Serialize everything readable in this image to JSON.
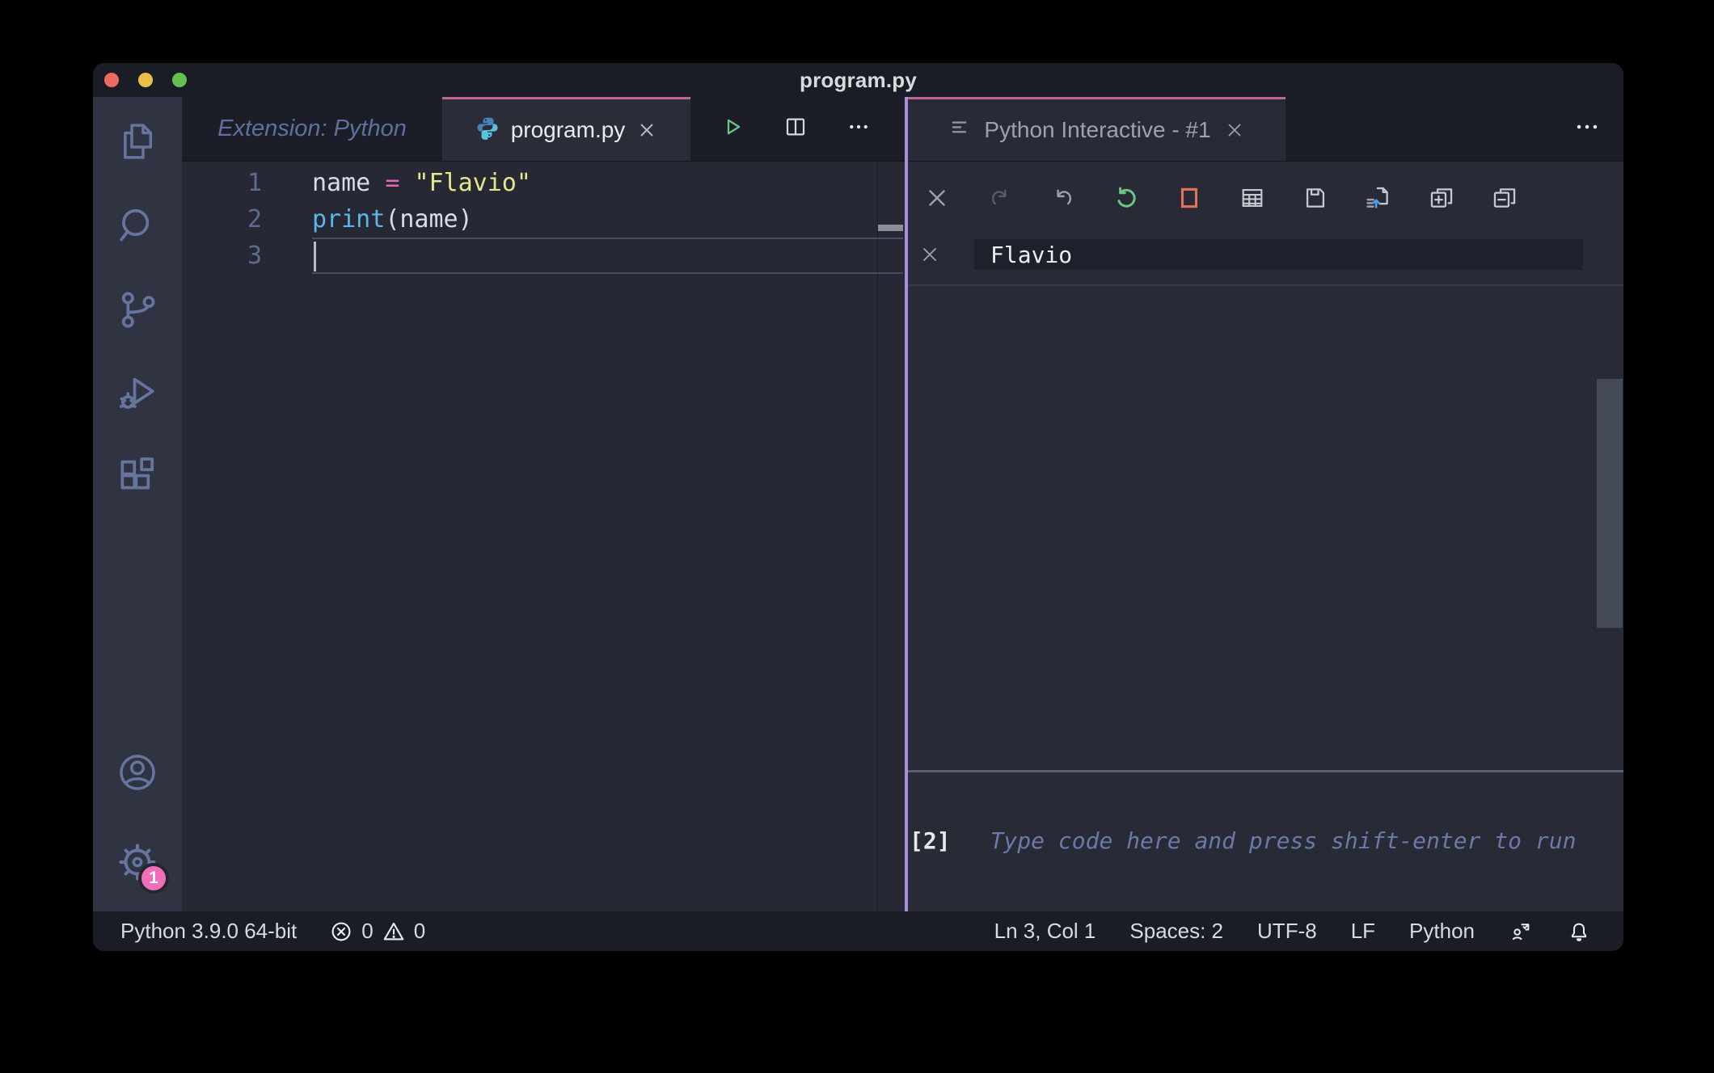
{
  "window": {
    "title": "program.py"
  },
  "theme": {
    "accent_pink": "#c06795",
    "sash_purple": "#a98fd9",
    "badge_pink": "#f06eb7",
    "green": "#6dc583",
    "red_orange": "#e2725c",
    "python_logo_blue": "#4584b6",
    "python_logo_cyan": "#5ac2e0",
    "code_pink": "#e566b5",
    "code_yellow": "#e5e78a",
    "code_blue": "#5fb4e8"
  },
  "activity_bar": {
    "settings_badge": "1",
    "icons": [
      "explorer-icon",
      "search-icon",
      "source-control-icon",
      "run-debug-icon",
      "extensions-icon",
      "account-icon",
      "settings-gear-icon"
    ]
  },
  "editor": {
    "tabs": {
      "preview_label": "Extension: Python",
      "active_label": "program.py"
    },
    "line_numbers": [
      "1",
      "2",
      "3"
    ],
    "code": {
      "line1": {
        "t1": "name ",
        "t2": "= ",
        "t3": "\"Flavio\""
      },
      "line2": {
        "t1": "print",
        "t2": "(name)"
      }
    }
  },
  "panel": {
    "tab_label": "Python Interactive - #1",
    "toolbar_icons": [
      "clear-icon",
      "redo-icon",
      "undo-icon",
      "restart-kernel-icon",
      "interrupt-kernel-icon",
      "variable-explorer-icon",
      "save-icon",
      "export-icon",
      "expand-all-icon",
      "collapse-all-icon"
    ],
    "output": {
      "value": "Flavio"
    },
    "input": {
      "prompt": "[2]",
      "placeholder": "Type code here and press shift-enter to run"
    }
  },
  "status_bar": {
    "python_version": "Python 3.9.0 64-bit",
    "error_count": "0",
    "warning_count": "0",
    "cursor_position": "Ln 3, Col 1",
    "indentation": "Spaces: 2",
    "encoding": "UTF-8",
    "eol": "LF",
    "language": "Python"
  }
}
